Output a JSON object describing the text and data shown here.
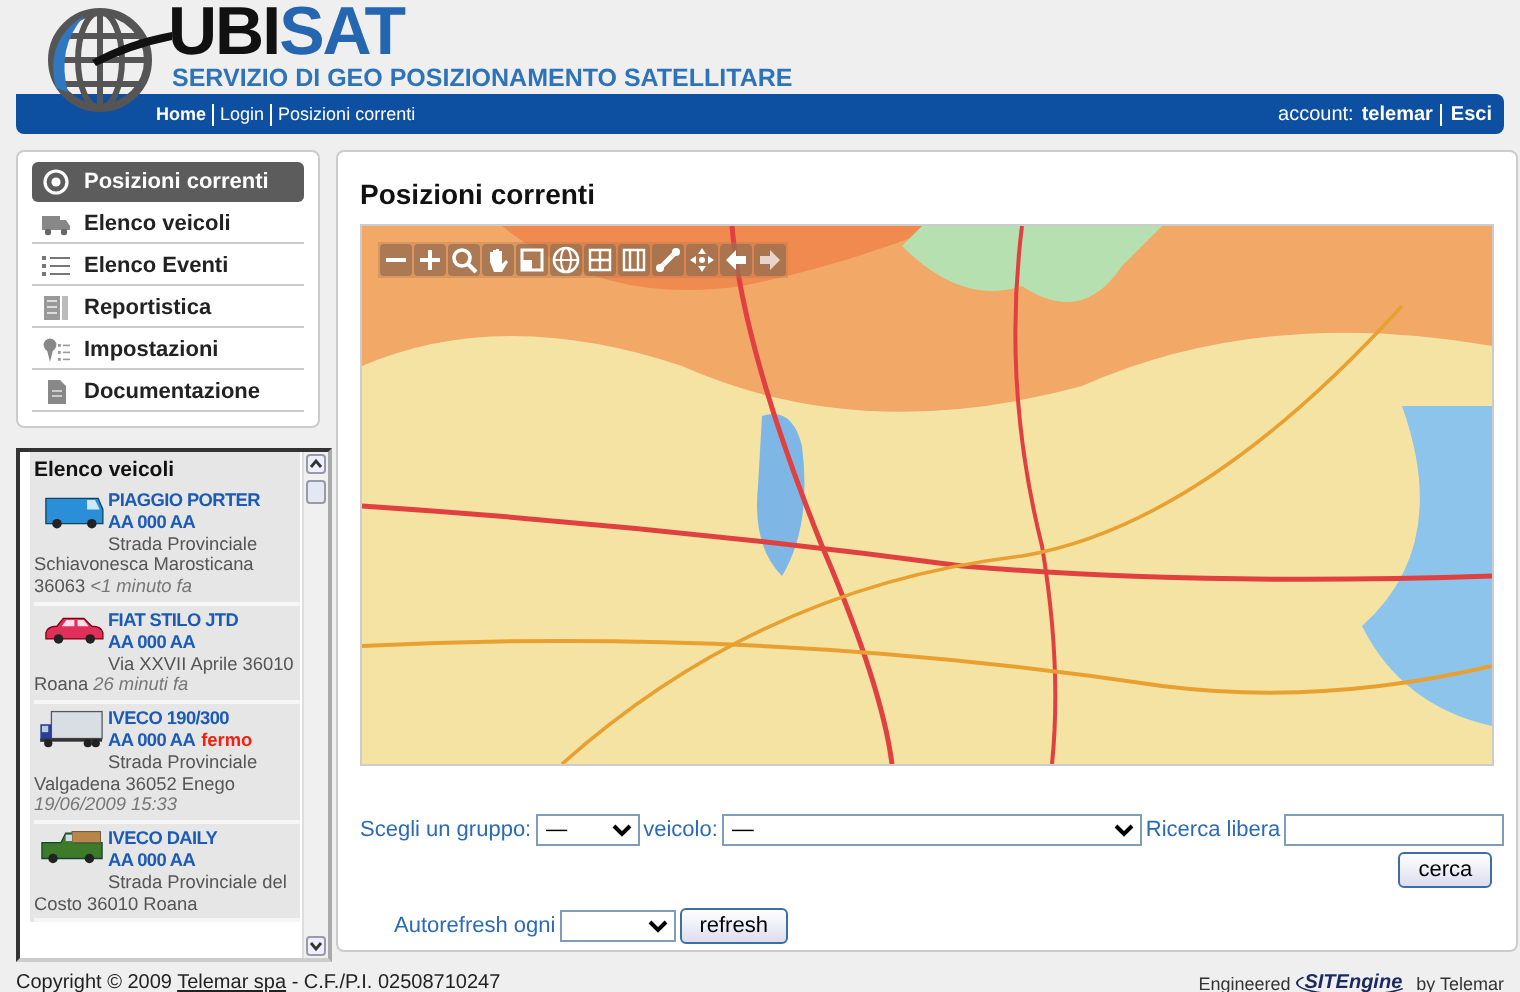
{
  "header": {
    "logo": {
      "first": "UBI",
      "second": "SAT"
    },
    "tagline": "SERVIZIO DI GEO POSIZIONAMENTO SATELLITARE"
  },
  "nav": {
    "breadcrumbs": [
      {
        "label": "Home",
        "current": true
      },
      {
        "label": "Login",
        "current": false
      },
      {
        "label": "Posizioni correnti",
        "current": false
      }
    ],
    "account_label": "account:",
    "account": "telemar",
    "logout": "Esci"
  },
  "menu": [
    {
      "label": "Posizioni correnti",
      "kind": "target",
      "selected": true
    },
    {
      "label": "Elenco veicoli",
      "kind": "truck",
      "selected": false
    },
    {
      "label": "Elenco Eventi",
      "kind": "list",
      "selected": false
    },
    {
      "label": "Reportistica",
      "kind": "report",
      "selected": false
    },
    {
      "label": "Impostazioni",
      "kind": "settings",
      "selected": false
    },
    {
      "label": "Documentazione",
      "kind": "document",
      "selected": false
    }
  ],
  "vehicles": {
    "title": "Elenco veicoli",
    "items": [
      {
        "kind": "van",
        "name": "PIAGGIO PORTER",
        "plate": "AA 000 AA",
        "address": "Strada Provinciale Schiavonesca Marosticana 36063",
        "time": "<1 minuto fa"
      },
      {
        "kind": "car",
        "name": "FIAT STILO JTD",
        "plate": "AA 000 AA",
        "address": "Via XXVII Aprile 36010 Roana",
        "time": "26 minuti fa"
      },
      {
        "kind": "truck",
        "name": "IVECO 190/300",
        "plate": "AA 000 AA",
        "status": "fermo",
        "address": "Strada Provinciale Valgadena 36052 Enego",
        "time": "19/06/2009 15:33"
      },
      {
        "kind": "pickup",
        "name": "IVECO DAILY",
        "plate": "AA 000 AA",
        "address": "Strada Provinciale del Costo 36010 Roana"
      }
    ]
  },
  "main": {
    "title": "Posizioni correnti",
    "form": {
      "group_label": "Scegli un gruppo:",
      "group_value": "—",
      "vehicle_label": "veicolo:",
      "vehicle_value": "—",
      "search_label": "Ricerca libera",
      "search_button": "cerca",
      "refresh_label": "Autorefresh ogni",
      "refresh_button": "refresh"
    }
  },
  "footer": {
    "copyright_before": "Copyright © 2009 ",
    "company": "Telemar spa",
    "copyright_after": " - C.F./P.I. 02508710247",
    "engineered": "Engineered",
    "brand": "SITEngine",
    "by": "by Telemar"
  }
}
